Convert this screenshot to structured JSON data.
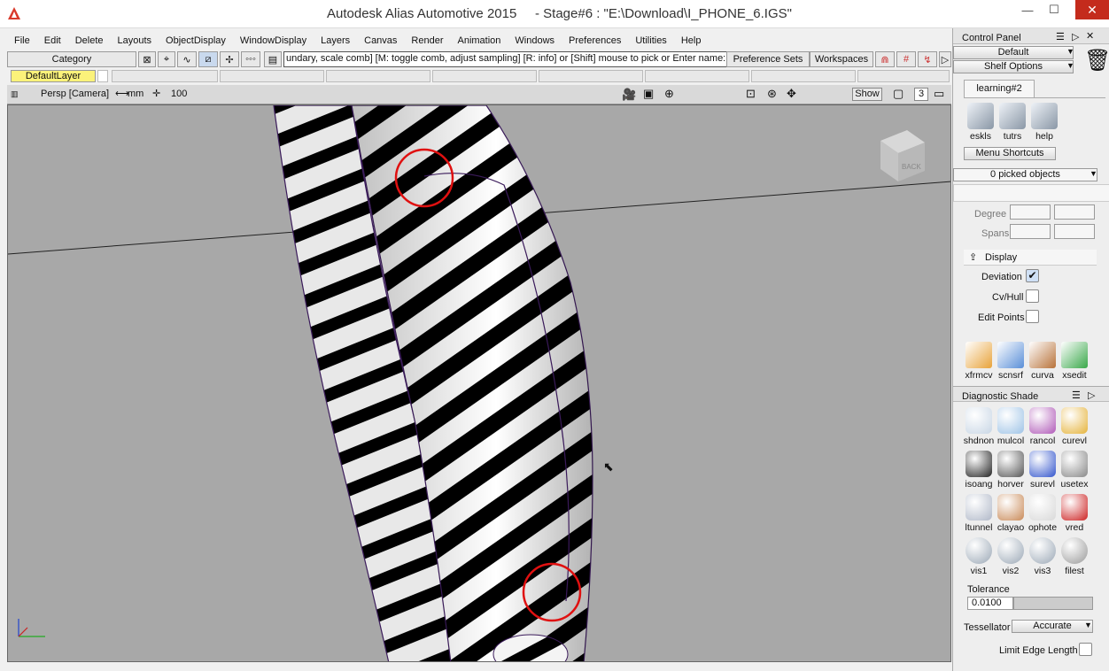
{
  "window": {
    "app_title": "Autodesk Alias Automotive 2015",
    "doc_title": "- Stage#6 : \"E:\\Download\\I_PHONE_6.IGS\"",
    "minimize": "—",
    "maximize": "☐",
    "close": "✕"
  },
  "menu": [
    "File",
    "Edit",
    "Delete",
    "Layouts",
    "ObjectDisplay",
    "WindowDisplay",
    "Layers",
    "Canvas",
    "Render",
    "Animation",
    "Windows",
    "Preferences",
    "Utilities",
    "Help"
  ],
  "toolbar": {
    "category": "Category",
    "prompt": "undary, scale comb] [M: toggle comb, adjust sampling] [R: info] or [Shift] mouse to pick or Enter name:",
    "preference_sets": "Preference Sets",
    "workspaces": "Workspaces"
  },
  "layer": {
    "default": "DefaultLayer"
  },
  "viewport": {
    "camera": "Persp [Camera]",
    "units": "mm",
    "grid": "100",
    "show": "Show",
    "count": "3",
    "back": "BACK"
  },
  "panel": {
    "title": "Control Panel",
    "default": "Default",
    "shelf_options": "Shelf Options",
    "shelf_tab": "learning#2",
    "shelf_items": [
      {
        "label": "eskls",
        "icon": "eskls-icon"
      },
      {
        "label": "tutrs",
        "icon": "tutrs-icon"
      },
      {
        "label": "help",
        "icon": "help-icon"
      }
    ],
    "menu_shortcuts": "Menu Shortcuts",
    "picked": "0 picked objects",
    "degree": "Degree",
    "spans": "Spans",
    "display": "Display",
    "deviation": "Deviation",
    "cvhull": "Cv/Hull",
    "edit_points": "Edit Points",
    "tools": [
      {
        "label": "xfrmcv"
      },
      {
        "label": "scnsrf"
      },
      {
        "label": "curva"
      },
      {
        "label": "xsedit"
      }
    ],
    "diag_title": "Diagnostic Shade",
    "diag": [
      {
        "label": "shdnon",
        "color": "#c8d6e5"
      },
      {
        "label": "mulcol",
        "color": "#9ec3e6"
      },
      {
        "label": "rancol",
        "color": "#b05ab8"
      },
      {
        "label": "curevl",
        "color": "#e5b33b"
      },
      {
        "label": "isoang",
        "color": "#222222"
      },
      {
        "label": "horver",
        "color": "#555555"
      },
      {
        "label": "surevl",
        "color": "#3355cc"
      },
      {
        "label": "usetex",
        "color": "#888888"
      },
      {
        "label": "ltunnel",
        "color": "#b0b8c8"
      },
      {
        "label": "clayao",
        "color": "#c98a58"
      },
      {
        "label": "ophote",
        "color": "#d8d8d8"
      },
      {
        "label": "vred",
        "color": "#cc2222"
      },
      {
        "label": "vis1",
        "color": "#9aa7b5"
      },
      {
        "label": "vis2",
        "color": "#9aa7b5"
      },
      {
        "label": "vis3",
        "color": "#9aa7b5"
      },
      {
        "label": "filest",
        "color": "#999999"
      }
    ],
    "tolerance": "Tolerance",
    "tolerance_value": "0.0100",
    "tessellator": "Tessellator",
    "tessellator_value": "Accurate",
    "limit_edge": "Limit Edge Length"
  }
}
